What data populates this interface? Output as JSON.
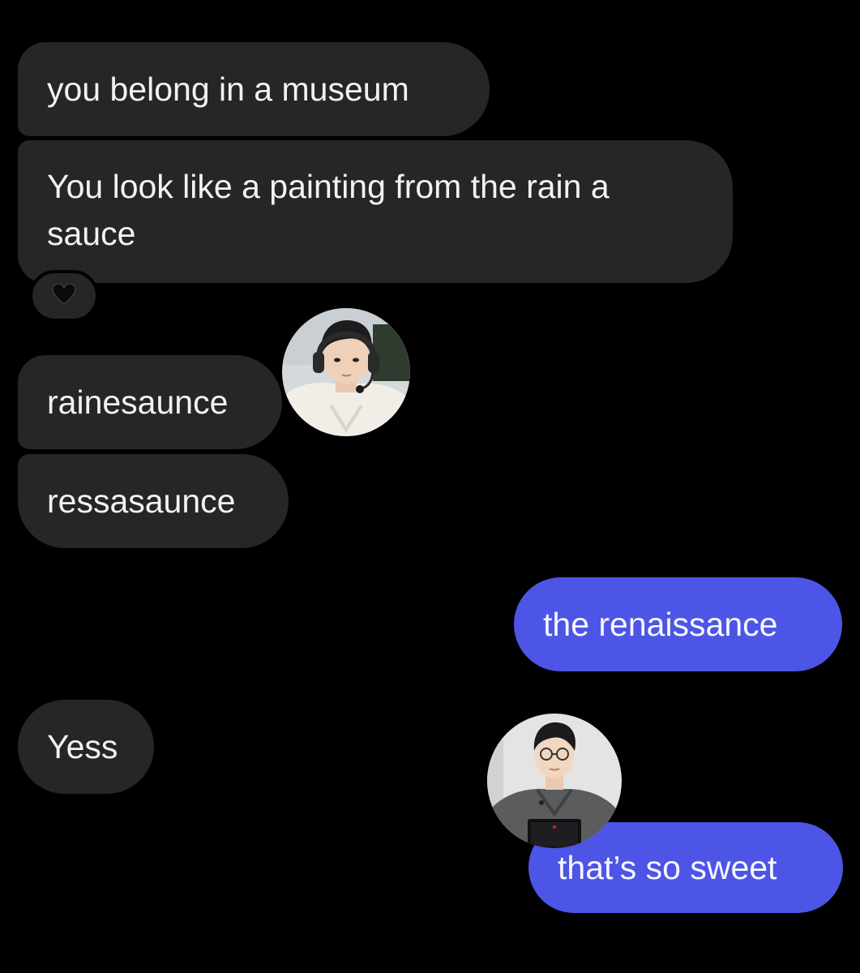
{
  "conversation": {
    "messages": [
      {
        "sender": "them",
        "text": "you belong in a museum"
      },
      {
        "sender": "them",
        "text": "You look like a painting from the rain a sauce",
        "reaction": "black-heart-icon"
      },
      {
        "sender": "them",
        "text": "rainesaunce"
      },
      {
        "sender": "them",
        "text": "ressasaunce"
      },
      {
        "sender": "me",
        "text": "the renaissance"
      },
      {
        "sender": "them",
        "text": "Yess"
      },
      {
        "sender": "me",
        "text": "that’s so sweet"
      }
    ]
  },
  "colors": {
    "background": "#000000",
    "incoming_bubble": "#262626",
    "outgoing_bubble": "#4d55e6",
    "text": "#f2f2f2"
  },
  "avatars": [
    {
      "name": "user-avatar-headset"
    },
    {
      "name": "user-avatar-glasses"
    }
  ]
}
